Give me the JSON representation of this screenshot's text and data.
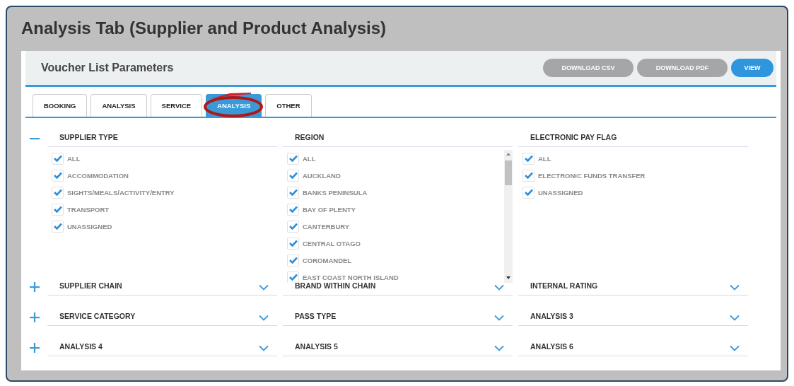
{
  "title": "Analysis Tab (Supplier and Product Analysis)",
  "panel": {
    "title": "Voucher List Parameters",
    "buttons": [
      {
        "label": "DOWNLOAD CSV",
        "kind": "secondary"
      },
      {
        "label": "DOWNLOAD PDF",
        "kind": "secondary"
      },
      {
        "label": "VIEW",
        "kind": "primary"
      }
    ]
  },
  "tabs": [
    {
      "label": "BOOKING",
      "selected": false,
      "circled": false
    },
    {
      "label": "ANALYSIS",
      "selected": false,
      "circled": false
    },
    {
      "label": "SERVICE",
      "selected": false,
      "circled": false
    },
    {
      "label": "ANALYSIS",
      "selected": true,
      "circled": true
    },
    {
      "label": "OTHER",
      "selected": false,
      "circled": false
    }
  ],
  "rows": [
    {
      "expanded": true,
      "filters": [
        {
          "label": "SUPPLIER TYPE",
          "options": [
            {
              "label": "ALL",
              "checked": true
            },
            {
              "label": "ACCOMMODATION",
              "checked": true
            },
            {
              "label": "SIGHTS/MEALS/ACTIVITY/ENTRY",
              "checked": true
            },
            {
              "label": "TRANSPORT",
              "checked": true
            },
            {
              "label": "UNASSIGNED",
              "checked": true
            }
          ]
        },
        {
          "label": "REGION",
          "scrollable": true,
          "options": [
            {
              "label": "ALL",
              "checked": true
            },
            {
              "label": "AUCKLAND",
              "checked": true
            },
            {
              "label": "BANKS PENINSULA",
              "checked": true
            },
            {
              "label": "BAY OF PLENTY",
              "checked": true
            },
            {
              "label": "CANTERBURY",
              "checked": true
            },
            {
              "label": "CENTRAL OTAGO",
              "checked": true
            },
            {
              "label": "COROMANDEL",
              "checked": true
            },
            {
              "label": "EAST COAST NORTH ISLAND",
              "checked": true
            }
          ]
        },
        {
          "label": "ELECTRONIC PAY FLAG",
          "options": [
            {
              "label": "ALL",
              "checked": true
            },
            {
              "label": "ELECTRONIC FUNDS TRANSFER",
              "checked": true
            },
            {
              "label": "UNASSIGNED",
              "checked": true
            }
          ]
        }
      ]
    },
    {
      "expanded": false,
      "filters": [
        {
          "label": "SUPPLIER CHAIN"
        },
        {
          "label": "BRAND WITHIN CHAIN"
        },
        {
          "label": "INTERNAL RATING"
        }
      ]
    },
    {
      "expanded": false,
      "filters": [
        {
          "label": "SERVICE CATEGORY"
        },
        {
          "label": "PASS TYPE"
        },
        {
          "label": "ANALYSIS 3"
        }
      ]
    },
    {
      "expanded": false,
      "filters": [
        {
          "label": "ANALYSIS 4"
        },
        {
          "label": "ANALYSIS 5"
        },
        {
          "label": "ANALYSIS 6"
        }
      ]
    }
  ]
}
